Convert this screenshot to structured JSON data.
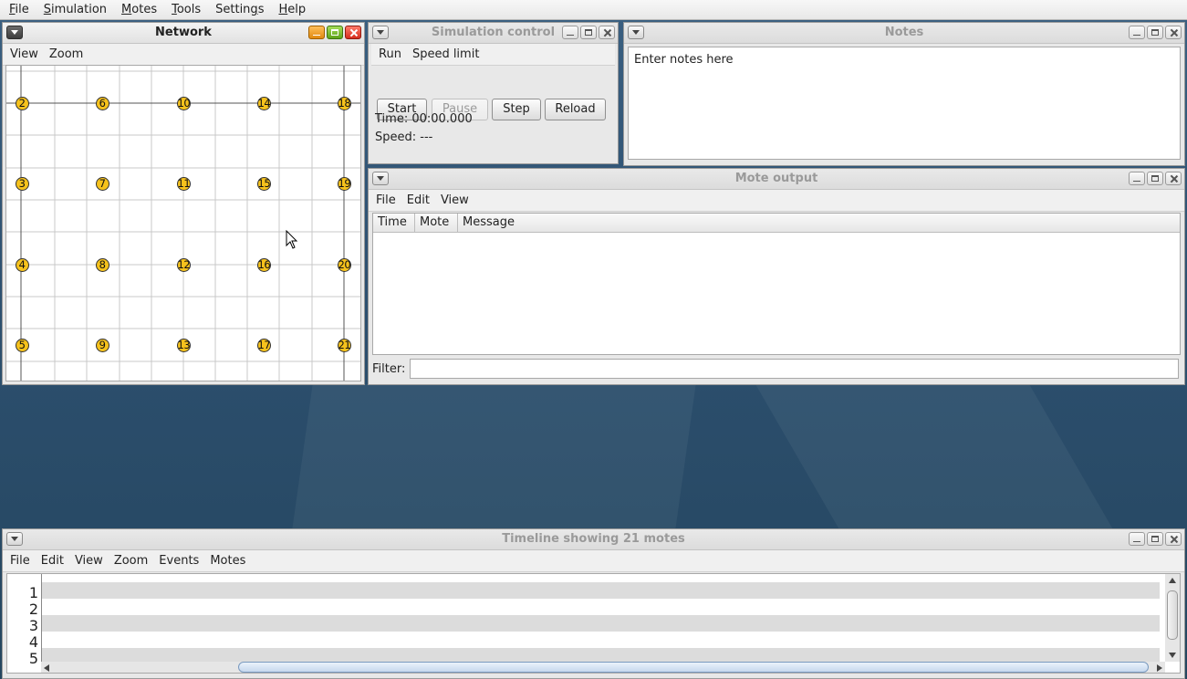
{
  "menubar": {
    "items": [
      {
        "pre": "",
        "u": "F",
        "post": "ile"
      },
      {
        "pre": "",
        "u": "S",
        "post": "imulation"
      },
      {
        "pre": "",
        "u": "M",
        "post": "otes"
      },
      {
        "pre": "",
        "u": "T",
        "post": "ools"
      },
      {
        "pre": "Settin",
        "u": "g",
        "post": "s"
      },
      {
        "pre": "",
        "u": "H",
        "post": "elp"
      }
    ]
  },
  "network": {
    "title": "Network",
    "menu": [
      "View",
      "Zoom"
    ],
    "motes": [
      "2",
      "6",
      "10",
      "14",
      "18",
      "3",
      "7",
      "11",
      "15",
      "19",
      "4",
      "8",
      "12",
      "16",
      "20",
      "5",
      "9",
      "13",
      "17",
      "21"
    ]
  },
  "simcontrol": {
    "title": "Simulation control",
    "menu": [
      "Run",
      "Speed limit"
    ],
    "buttons": {
      "start": "Start",
      "pause": "Pause",
      "step": "Step",
      "reload": "Reload"
    },
    "time_label": "Time: 00:00.000",
    "speed_label": "Speed: ---"
  },
  "notes": {
    "title": "Notes",
    "text": "Enter notes here"
  },
  "moteoutput": {
    "title": "Mote output",
    "menu": [
      "File",
      "Edit",
      "View"
    ],
    "columns": [
      "Time",
      "Mote",
      "Message"
    ],
    "filter_label": "Filter:",
    "filter_value": ""
  },
  "timeline": {
    "title": "Timeline showing 21 motes",
    "menu": [
      "File",
      "Edit",
      "View",
      "Zoom",
      "Events",
      "Motes"
    ],
    "rows": [
      "1",
      "2",
      "3",
      "4",
      "5"
    ]
  }
}
